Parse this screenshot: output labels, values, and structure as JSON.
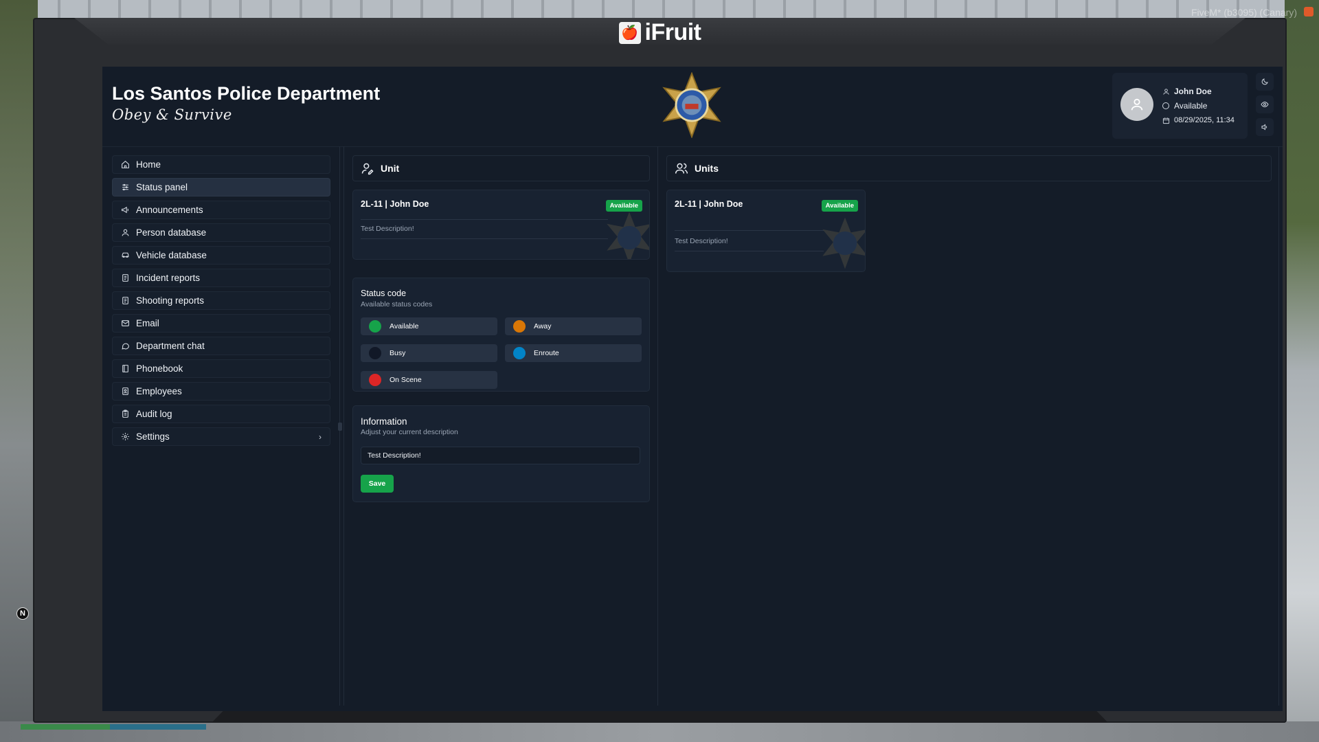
{
  "device": {
    "brand": "iFruit"
  },
  "overlay": {
    "client_label": "FiveM* (b3095) (Canary)"
  },
  "header": {
    "title": "Los Santos Police Department",
    "motto": "Obey & Survive"
  },
  "user": {
    "name": "John Doe",
    "status": "Available",
    "datetime": "08/29/2025, 11:34"
  },
  "sidebar": {
    "items": [
      {
        "label": "Home",
        "icon": "home-icon"
      },
      {
        "label": "Status panel",
        "icon": "sliders-icon"
      },
      {
        "label": "Announcements",
        "icon": "megaphone-icon"
      },
      {
        "label": "Person database",
        "icon": "person-icon"
      },
      {
        "label": "Vehicle database",
        "icon": "car-icon"
      },
      {
        "label": "Incident reports",
        "icon": "report-icon"
      },
      {
        "label": "Shooting reports",
        "icon": "report-icon"
      },
      {
        "label": "Email",
        "icon": "mail-icon"
      },
      {
        "label": "Department chat",
        "icon": "chat-icon"
      },
      {
        "label": "Phonebook",
        "icon": "book-icon"
      },
      {
        "label": "Employees",
        "icon": "id-card-icon"
      },
      {
        "label": "Audit log",
        "icon": "clipboard-icon"
      },
      {
        "label": "Settings",
        "icon": "gear-icon"
      }
    ],
    "active_index": 1
  },
  "unit_panel": {
    "title": "Unit",
    "card": {
      "title": "2L-11 | John Doe",
      "badge": "Available",
      "description": "Test Description!"
    },
    "status": {
      "title": "Status code",
      "subtitle": "Available status codes",
      "options": [
        {
          "label": "Available",
          "color": "#16a34a"
        },
        {
          "label": "Away",
          "color": "#d97706"
        },
        {
          "label": "Busy",
          "color": "#111827"
        },
        {
          "label": "Enroute",
          "color": "#0284c7"
        },
        {
          "label": "On Scene",
          "color": "#dc2626"
        }
      ]
    },
    "info": {
      "title": "Information",
      "subtitle": "Adjust your current description",
      "value": "Test Description!",
      "save_label": "Save"
    }
  },
  "units_panel": {
    "title": "Units",
    "cards": [
      {
        "title": "2L-11 | John Doe",
        "badge": "Available",
        "description": "Test Description!"
      }
    ]
  },
  "colors": {
    "accent_green": "#16a34a",
    "background": "#141c28",
    "panel": "#182231"
  }
}
